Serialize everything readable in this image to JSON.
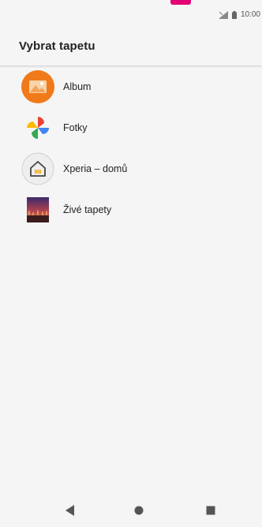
{
  "status_bar": {
    "time": "10:00",
    "icons": [
      "signal-icon",
      "battery-icon"
    ],
    "accent_color": "#e20074"
  },
  "app_bar": {
    "title": "Vybrat tapetu"
  },
  "list": {
    "items": [
      {
        "label": "Album",
        "icon": "album-icon"
      },
      {
        "label": "Fotky",
        "icon": "photos-pinwheel-icon"
      },
      {
        "label": "Xperia – domů",
        "icon": "xperia-home-icon"
      },
      {
        "label": "Živé tapety",
        "icon": "live-wallpaper-icon"
      }
    ]
  },
  "nav_bar": {
    "buttons": [
      "back-icon",
      "home-icon",
      "recents-icon"
    ]
  }
}
